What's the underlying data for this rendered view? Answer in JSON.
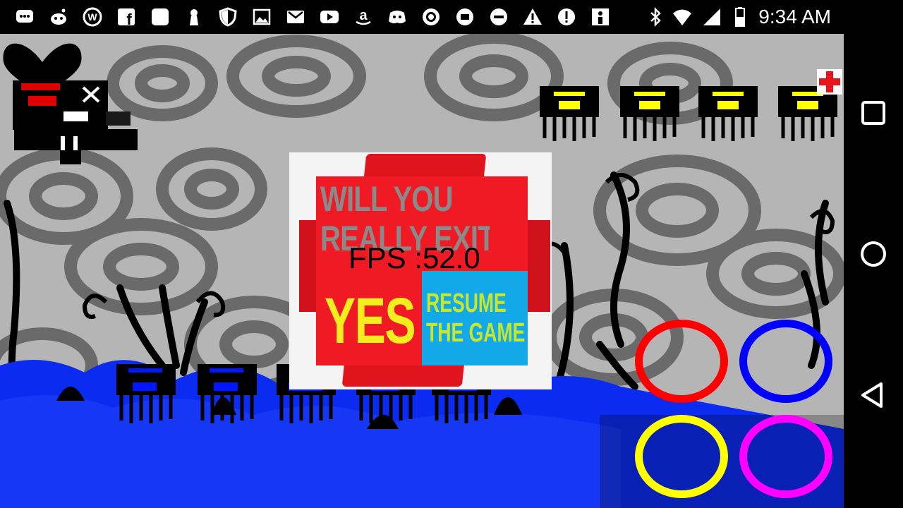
{
  "status_bar": {
    "time": "9:34 AM",
    "left_icons": [
      "messages-icon",
      "reddit-icon",
      "wordpress-icon",
      "facebook-icon",
      "app-icon",
      "keyhole-icon",
      "shield-icon",
      "image-icon",
      "gmail-icon",
      "youtube-icon",
      "amazon-icon",
      "discord-icon",
      "camera-icon",
      "app-icon",
      "minus-circle-icon",
      "warning-icon",
      "alert-icon",
      "app-icon"
    ],
    "right_icons": [
      "bluetooth-icon",
      "wifi-icon",
      "signal-icon",
      "battery-icon"
    ]
  },
  "nav_bar": {
    "buttons": [
      "recents-icon",
      "home-icon",
      "back-icon"
    ]
  },
  "dialog": {
    "question_line1": "WILL YOU",
    "question_line2": "REALLY EXIT",
    "yes_label": "YES",
    "resume_label": "RESUME\nTHE GAME",
    "fps_text": "FPS :52.0"
  },
  "controls": {
    "colors": {
      "red": "#ff0000",
      "blue": "#0000ff",
      "yellow": "#ffff00",
      "magenta": "#ff00ff"
    }
  },
  "colors": {
    "dialog_red": "#ef1a24",
    "resume_blue": "#13a8e8",
    "yes_yellow": "#f4ee1e",
    "ground_blue": "#0b2cf0"
  }
}
